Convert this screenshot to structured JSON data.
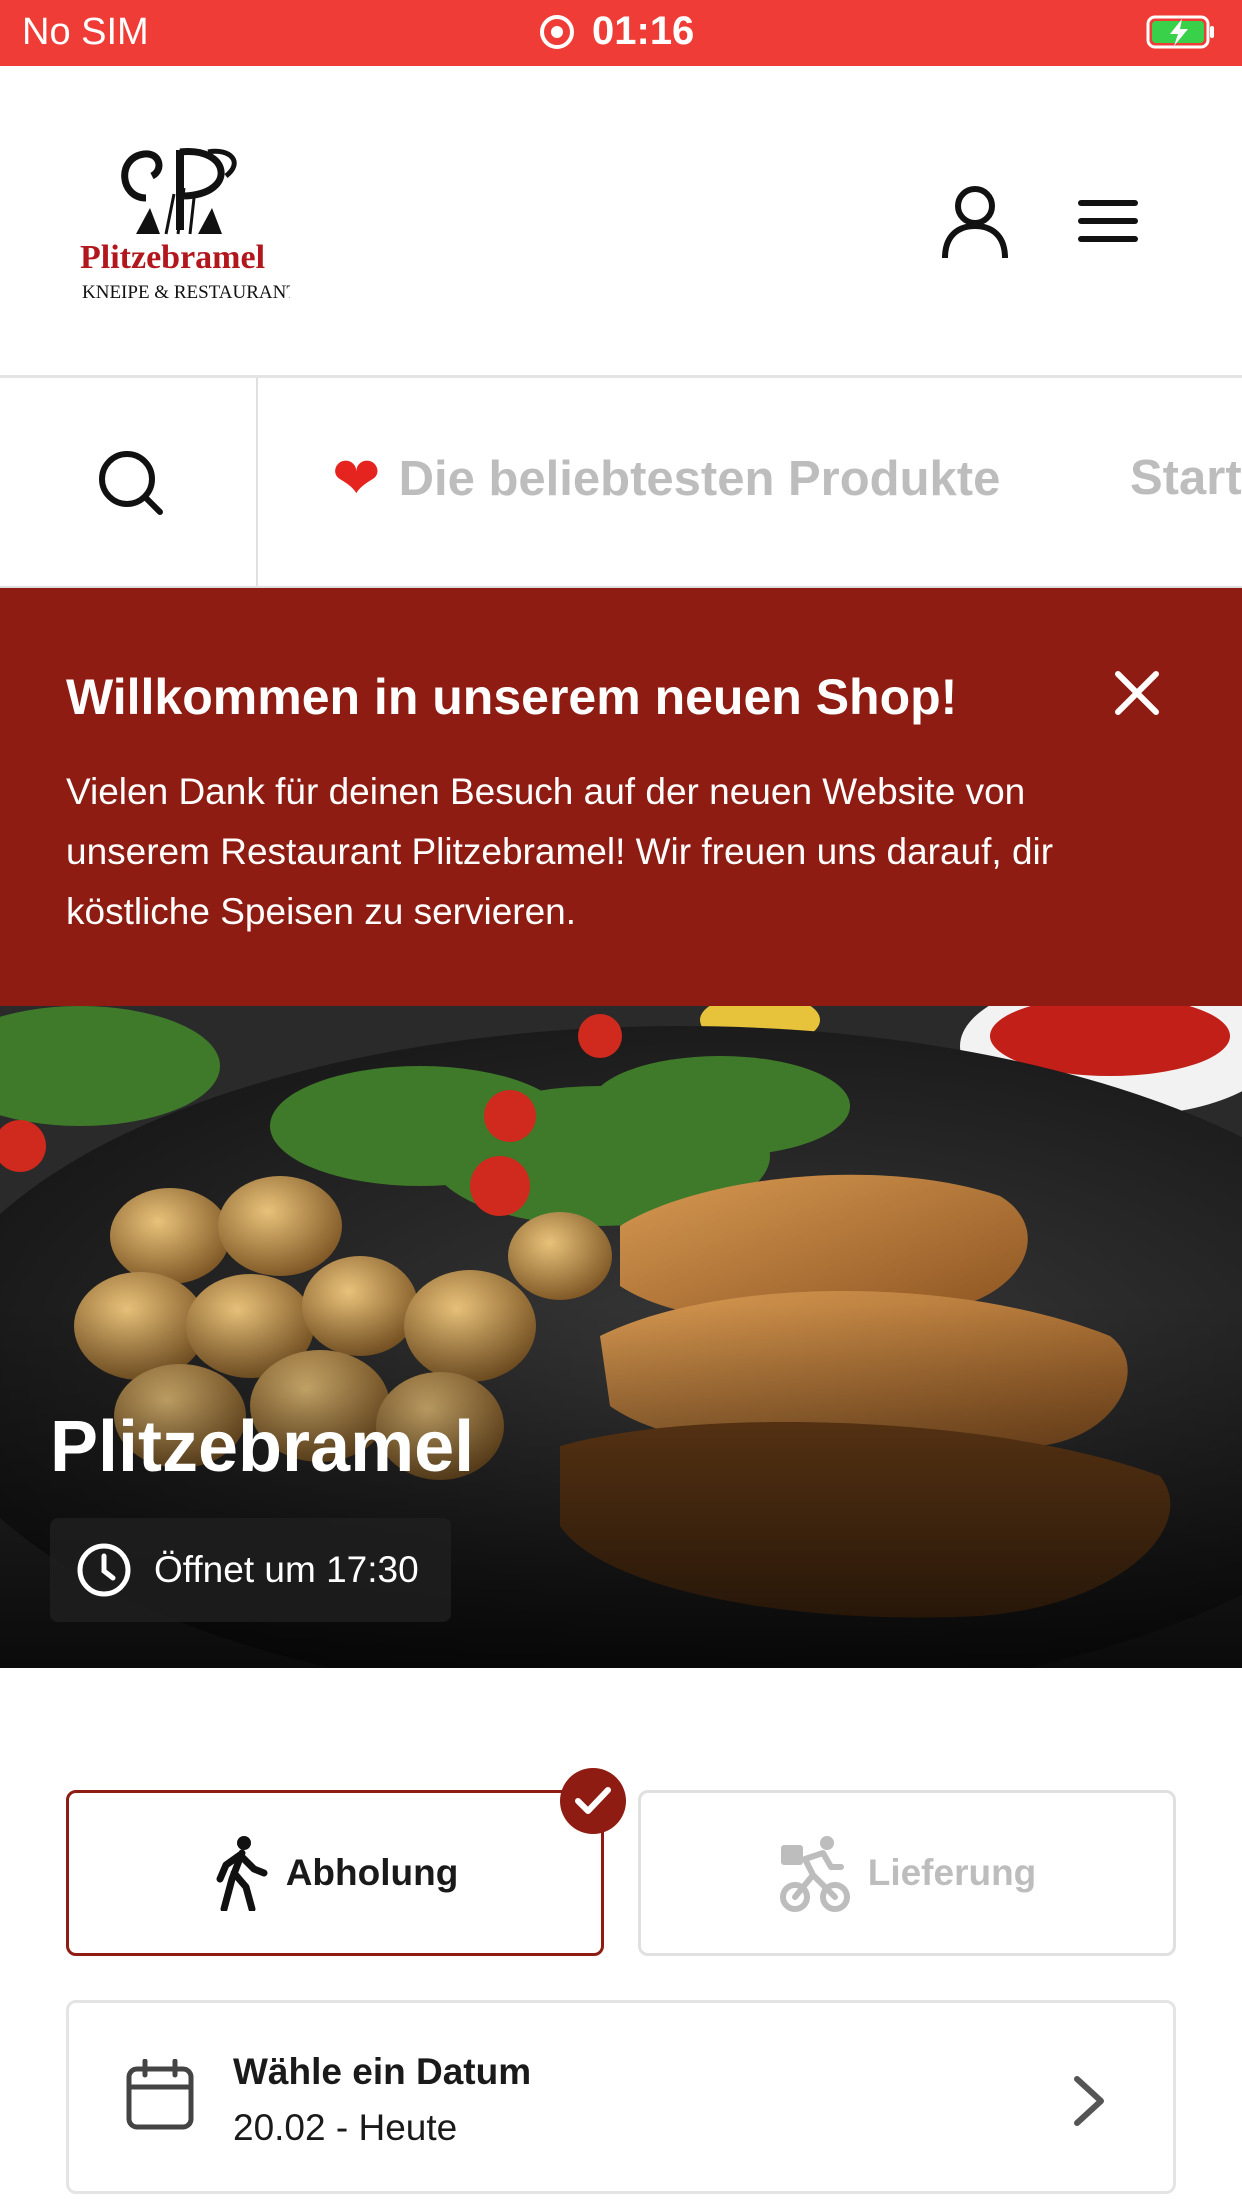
{
  "status_bar": {
    "carrier": "No SIM",
    "time": "01:16"
  },
  "header": {
    "logo": {
      "name": "Plitzebramel",
      "tagline": "KNEIPE & RESTAURANT"
    }
  },
  "nav": {
    "tabs": [
      {
        "label": "Die beliebtesten Produkte",
        "icon": "heart-icon"
      },
      {
        "label": "Start"
      }
    ]
  },
  "banner": {
    "title": "Willkommen in unserem neuen Shop!",
    "text": "Vielen Dank für deinen Besuch auf der neuen Website von unserem Restaurant Plitzebramel! Wir freuen uns darauf, dir köstliche Speisen zu servieren."
  },
  "hero": {
    "name": "Plitzebramel",
    "opening": "Öffnet um 17:30"
  },
  "order_options": {
    "pickup": "Abholung",
    "delivery": "Lieferung",
    "selected": "pickup"
  },
  "date_picker": {
    "label": "Wähle ein Datum",
    "value": "20.02 - Heute"
  },
  "colors": {
    "status_bar": "#f03c37",
    "brand": "#8f1c12",
    "muted_text": "#bdbdbd"
  }
}
